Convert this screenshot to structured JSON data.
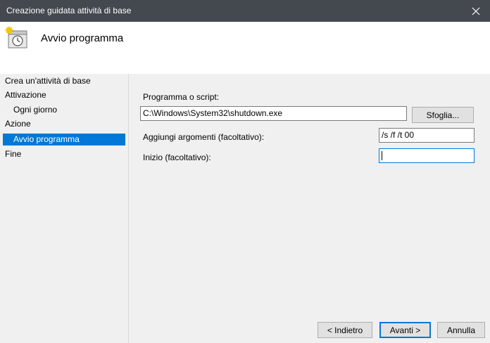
{
  "window": {
    "title": "Creazione guidata attività di base"
  },
  "header": {
    "title": "Avvio programma",
    "icon": "task-scheduler-icon"
  },
  "nav": {
    "items": [
      {
        "label": "Crea un'attività di base"
      },
      {
        "label": "Attivazione"
      },
      {
        "label": "Ogni giorno"
      },
      {
        "label": "Azione"
      },
      {
        "label": "Avvio programma"
      },
      {
        "label": "Fine"
      }
    ],
    "selected": "Avvio programma"
  },
  "form": {
    "program_label": "Programma o script:",
    "program_value": "C:\\Windows\\System32\\shutdown.exe",
    "browse_label": "Sfoglia...",
    "args_label": "Aggiungi argomenti (facoltativo):",
    "args_value": "/s /f /t 00",
    "start_label": "Inizio (facoltativo):",
    "start_value": ""
  },
  "footer": {
    "back_label": "< Indietro",
    "next_label": "Avanti >",
    "cancel_label": "Annulla"
  },
  "colors": {
    "titlebar": "#44494f",
    "accent": "#0078d7"
  }
}
